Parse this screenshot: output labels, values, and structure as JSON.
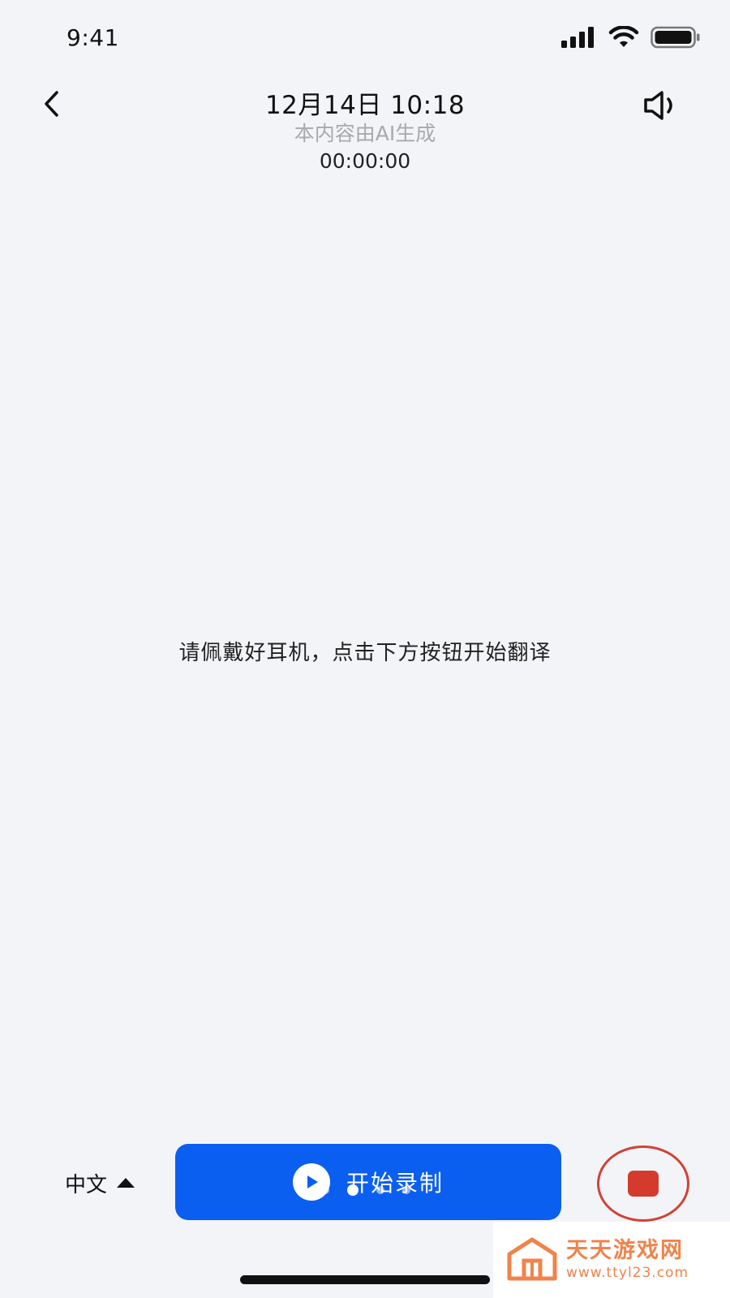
{
  "status_bar": {
    "time": "9:41",
    "icons": [
      "signal-icon",
      "wifi-icon",
      "battery-icon"
    ]
  },
  "header": {
    "date_time": "12月14日 10:18",
    "ai_notice": "本内容由AI生成",
    "duration": "00:00:00",
    "icons": [
      "back-chevron-icon",
      "speaker-icon"
    ]
  },
  "main": {
    "hint": "请佩戴好耳机，点击下方按钮开始翻译"
  },
  "controls": {
    "language": "中文",
    "record_label": "开始录制",
    "colors": {
      "record_button": "#0b5ff0",
      "stop_button": "#d43a2d"
    },
    "icons": [
      "caret-up-icon",
      "play-icon",
      "stop-square-icon"
    ]
  },
  "watermark": {
    "name": "天天游戏网",
    "url": "www.ttyl23.com",
    "color": "#f0834b"
  }
}
